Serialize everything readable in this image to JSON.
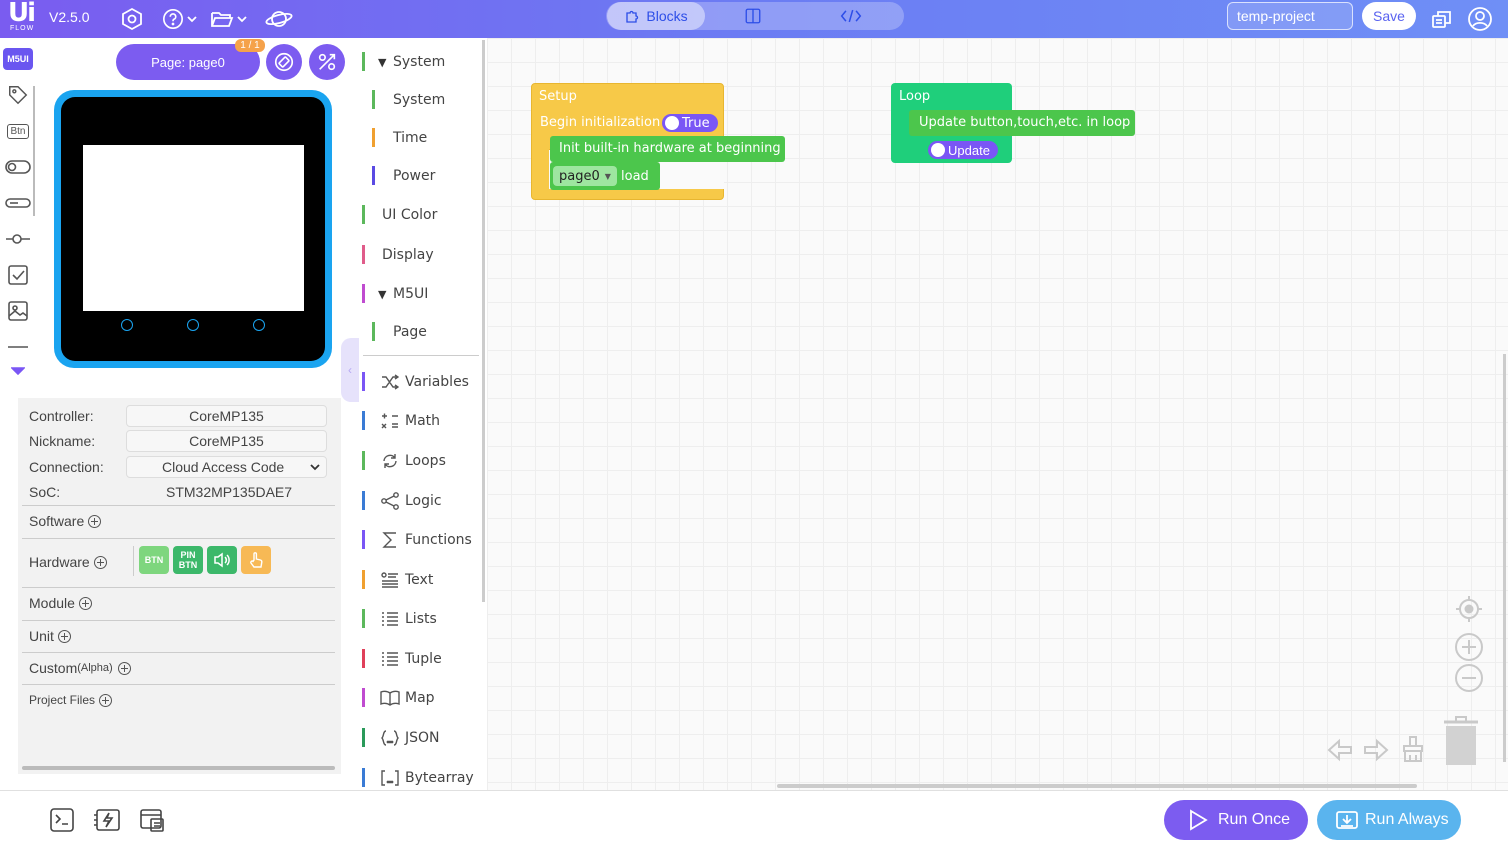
{
  "header": {
    "logo_main": "Ui",
    "logo_sub": "FLOW",
    "version": "V2.5.0",
    "view_tabs": {
      "blocks": "Blocks"
    },
    "project_name": "temp-project",
    "save_label": "Save"
  },
  "left_tools": {
    "m5ui_label": "M5UI",
    "btn_label": "Btn"
  },
  "device": {
    "page_button_label": "Page: page0",
    "page_badge": "1 / 1"
  },
  "info": {
    "controller_label": "Controller:",
    "controller_value": "CoreMP135",
    "nickname_label": "Nickname:",
    "nickname_value": "CoreMP135",
    "connection_label": "Connection:",
    "connection_value": "Cloud Access Code",
    "soc_label": "SoC:",
    "soc_value": "STM32MP135DAE7",
    "software_label": "Software",
    "hardware_label": "Hardware",
    "hardware_tiles": [
      "BTN",
      "PIN BTN"
    ],
    "module_label": "Module",
    "unit_label": "Unit",
    "custom_label": "Custom",
    "custom_suffix": "(Alpha)",
    "project_files_label": "Project Files"
  },
  "categories": [
    {
      "label": "System",
      "color": "#5cb85c",
      "caret": "▼"
    },
    {
      "label": "System",
      "color": "#5cb85c"
    },
    {
      "label": "Time",
      "color": "#f0a030"
    },
    {
      "label": "Power",
      "color": "#5a4ae3"
    },
    {
      "label": "UI Color",
      "color": "#5cb85c"
    },
    {
      "label": "Display",
      "color": "#e05c8a"
    },
    {
      "label": "M5UI",
      "color": "#c04bd0",
      "caret": "▼"
    },
    {
      "label": "Page",
      "color": "#5cb85c"
    },
    {
      "label": "Variables",
      "color": "#7a56f5"
    },
    {
      "label": "Math",
      "color": "#3a7bd5"
    },
    {
      "label": "Loops",
      "color": "#5cb85c"
    },
    {
      "label": "Logic",
      "color": "#3a7bd5"
    },
    {
      "label": "Functions",
      "color": "#7a56f5"
    },
    {
      "label": "Text",
      "color": "#f0a030"
    },
    {
      "label": "Lists",
      "color": "#5cb85c"
    },
    {
      "label": "Tuple",
      "color": "#e0405a"
    },
    {
      "label": "Map",
      "color": "#c04bd0"
    },
    {
      "label": "JSON",
      "color": "#2a9a5a"
    },
    {
      "label": "Bytearray",
      "color": "#3a7bd5"
    }
  ],
  "workspace": {
    "setup": {
      "title": "Setup",
      "begin_label": "Begin initialization",
      "begin_toggle": "True",
      "init_label": "Init built-in hardware at beginning",
      "page_dropdown": "page0",
      "load_label": "load"
    },
    "loop": {
      "title": "Loop",
      "update_label": "Update button,touch,etc. in loop",
      "update_toggle": "Update"
    }
  },
  "footer": {
    "run_once": "Run Once",
    "run_always": "Run Always"
  }
}
